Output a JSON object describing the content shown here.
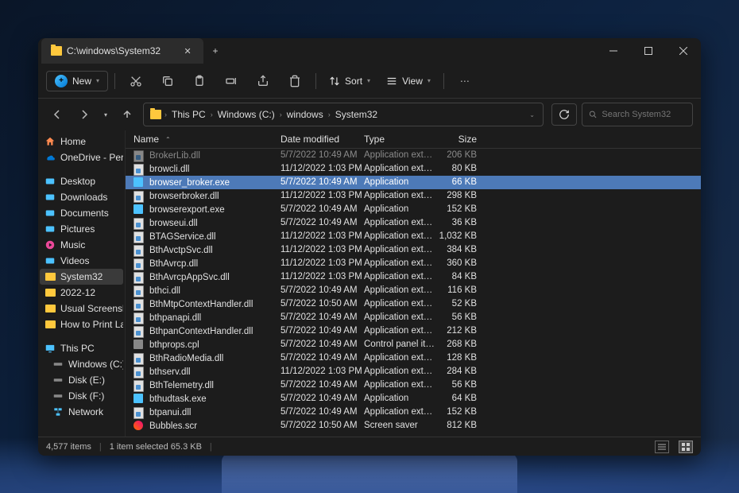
{
  "tab": {
    "title": "C:\\windows\\System32"
  },
  "toolbar": {
    "new_label": "New",
    "sort_label": "Sort",
    "view_label": "View"
  },
  "breadcrumb": [
    "This PC",
    "Windows (C:)",
    "windows",
    "System32"
  ],
  "search": {
    "placeholder": "Search System32"
  },
  "columns": {
    "name": "Name",
    "date": "Date modified",
    "type": "Type",
    "size": "Size"
  },
  "sidebar": {
    "items": [
      {
        "label": "Home",
        "icon": "home"
      },
      {
        "label": "OneDrive - Personal",
        "icon": "onedrive"
      }
    ],
    "quick": [
      {
        "label": "Desktop",
        "icon": "desktop"
      },
      {
        "label": "Downloads",
        "icon": "downloads"
      },
      {
        "label": "Documents",
        "icon": "documents"
      },
      {
        "label": "Pictures",
        "icon": "pictures"
      },
      {
        "label": "Music",
        "icon": "music"
      },
      {
        "label": "Videos",
        "icon": "videos"
      },
      {
        "label": "System32",
        "icon": "folder",
        "selected": true
      },
      {
        "label": "2022-12",
        "icon": "folder"
      },
      {
        "label": "Usual Screenshots",
        "icon": "folder"
      },
      {
        "label": "How to Print Labels f",
        "icon": "folder"
      }
    ],
    "pc": [
      {
        "label": "This PC",
        "icon": "thispc"
      },
      {
        "label": "Windows (C:)",
        "icon": "drive"
      },
      {
        "label": "Disk (E:)",
        "icon": "drive"
      },
      {
        "label": "Disk (F:)",
        "icon": "drive"
      },
      {
        "label": "Network",
        "icon": "network"
      }
    ]
  },
  "files": [
    {
      "name": "BrokerLib.dll",
      "date": "5/7/2022 10:49 AM",
      "type": "Application exten...",
      "size": "206 KB",
      "icon": "dll",
      "dim": true
    },
    {
      "name": "browcli.dll",
      "date": "11/12/2022 1:03 PM",
      "type": "Application exten...",
      "size": "80 KB",
      "icon": "dll"
    },
    {
      "name": "browser_broker.exe",
      "date": "5/7/2022 10:49 AM",
      "type": "Application",
      "size": "66 KB",
      "icon": "exe",
      "selected": true
    },
    {
      "name": "browserbroker.dll",
      "date": "11/12/2022 1:03 PM",
      "type": "Application exten...",
      "size": "298 KB",
      "icon": "dll"
    },
    {
      "name": "browserexport.exe",
      "date": "5/7/2022 10:49 AM",
      "type": "Application",
      "size": "152 KB",
      "icon": "exe"
    },
    {
      "name": "browseui.dll",
      "date": "5/7/2022 10:49 AM",
      "type": "Application exten...",
      "size": "36 KB",
      "icon": "dll"
    },
    {
      "name": "BTAGService.dll",
      "date": "11/12/2022 1:03 PM",
      "type": "Application exten...",
      "size": "1,032 KB",
      "icon": "dll"
    },
    {
      "name": "BthAvctpSvc.dll",
      "date": "11/12/2022 1:03 PM",
      "type": "Application exten...",
      "size": "384 KB",
      "icon": "dll"
    },
    {
      "name": "BthAvrcp.dll",
      "date": "11/12/2022 1:03 PM",
      "type": "Application exten...",
      "size": "360 KB",
      "icon": "dll"
    },
    {
      "name": "BthAvrcpAppSvc.dll",
      "date": "11/12/2022 1:03 PM",
      "type": "Application exten...",
      "size": "84 KB",
      "icon": "dll"
    },
    {
      "name": "bthci.dll",
      "date": "5/7/2022 10:49 AM",
      "type": "Application exten...",
      "size": "116 KB",
      "icon": "dll"
    },
    {
      "name": "BthMtpContextHandler.dll",
      "date": "5/7/2022 10:50 AM",
      "type": "Application exten...",
      "size": "52 KB",
      "icon": "dll"
    },
    {
      "name": "bthpanapi.dll",
      "date": "5/7/2022 10:49 AM",
      "type": "Application exten...",
      "size": "56 KB",
      "icon": "dll"
    },
    {
      "name": "BthpanContextHandler.dll",
      "date": "5/7/2022 10:49 AM",
      "type": "Application exten...",
      "size": "212 KB",
      "icon": "dll"
    },
    {
      "name": "bthprops.cpl",
      "date": "5/7/2022 10:49 AM",
      "type": "Control panel item",
      "size": "268 KB",
      "icon": "cpl"
    },
    {
      "name": "BthRadioMedia.dll",
      "date": "5/7/2022 10:49 AM",
      "type": "Application exten...",
      "size": "128 KB",
      "icon": "dll"
    },
    {
      "name": "bthserv.dll",
      "date": "11/12/2022 1:03 PM",
      "type": "Application exten...",
      "size": "284 KB",
      "icon": "dll"
    },
    {
      "name": "BthTelemetry.dll",
      "date": "5/7/2022 10:49 AM",
      "type": "Application exten...",
      "size": "56 KB",
      "icon": "dll"
    },
    {
      "name": "bthudtask.exe",
      "date": "5/7/2022 10:49 AM",
      "type": "Application",
      "size": "64 KB",
      "icon": "exe"
    },
    {
      "name": "btpanui.dll",
      "date": "5/7/2022 10:49 AM",
      "type": "Application exten...",
      "size": "152 KB",
      "icon": "dll"
    },
    {
      "name": "Bubbles.scr",
      "date": "5/7/2022 10:50 AM",
      "type": "Screen saver",
      "size": "812 KB",
      "icon": "scr"
    }
  ],
  "status": {
    "count": "4,577 items",
    "selected": "1 item selected  65.3 KB"
  }
}
